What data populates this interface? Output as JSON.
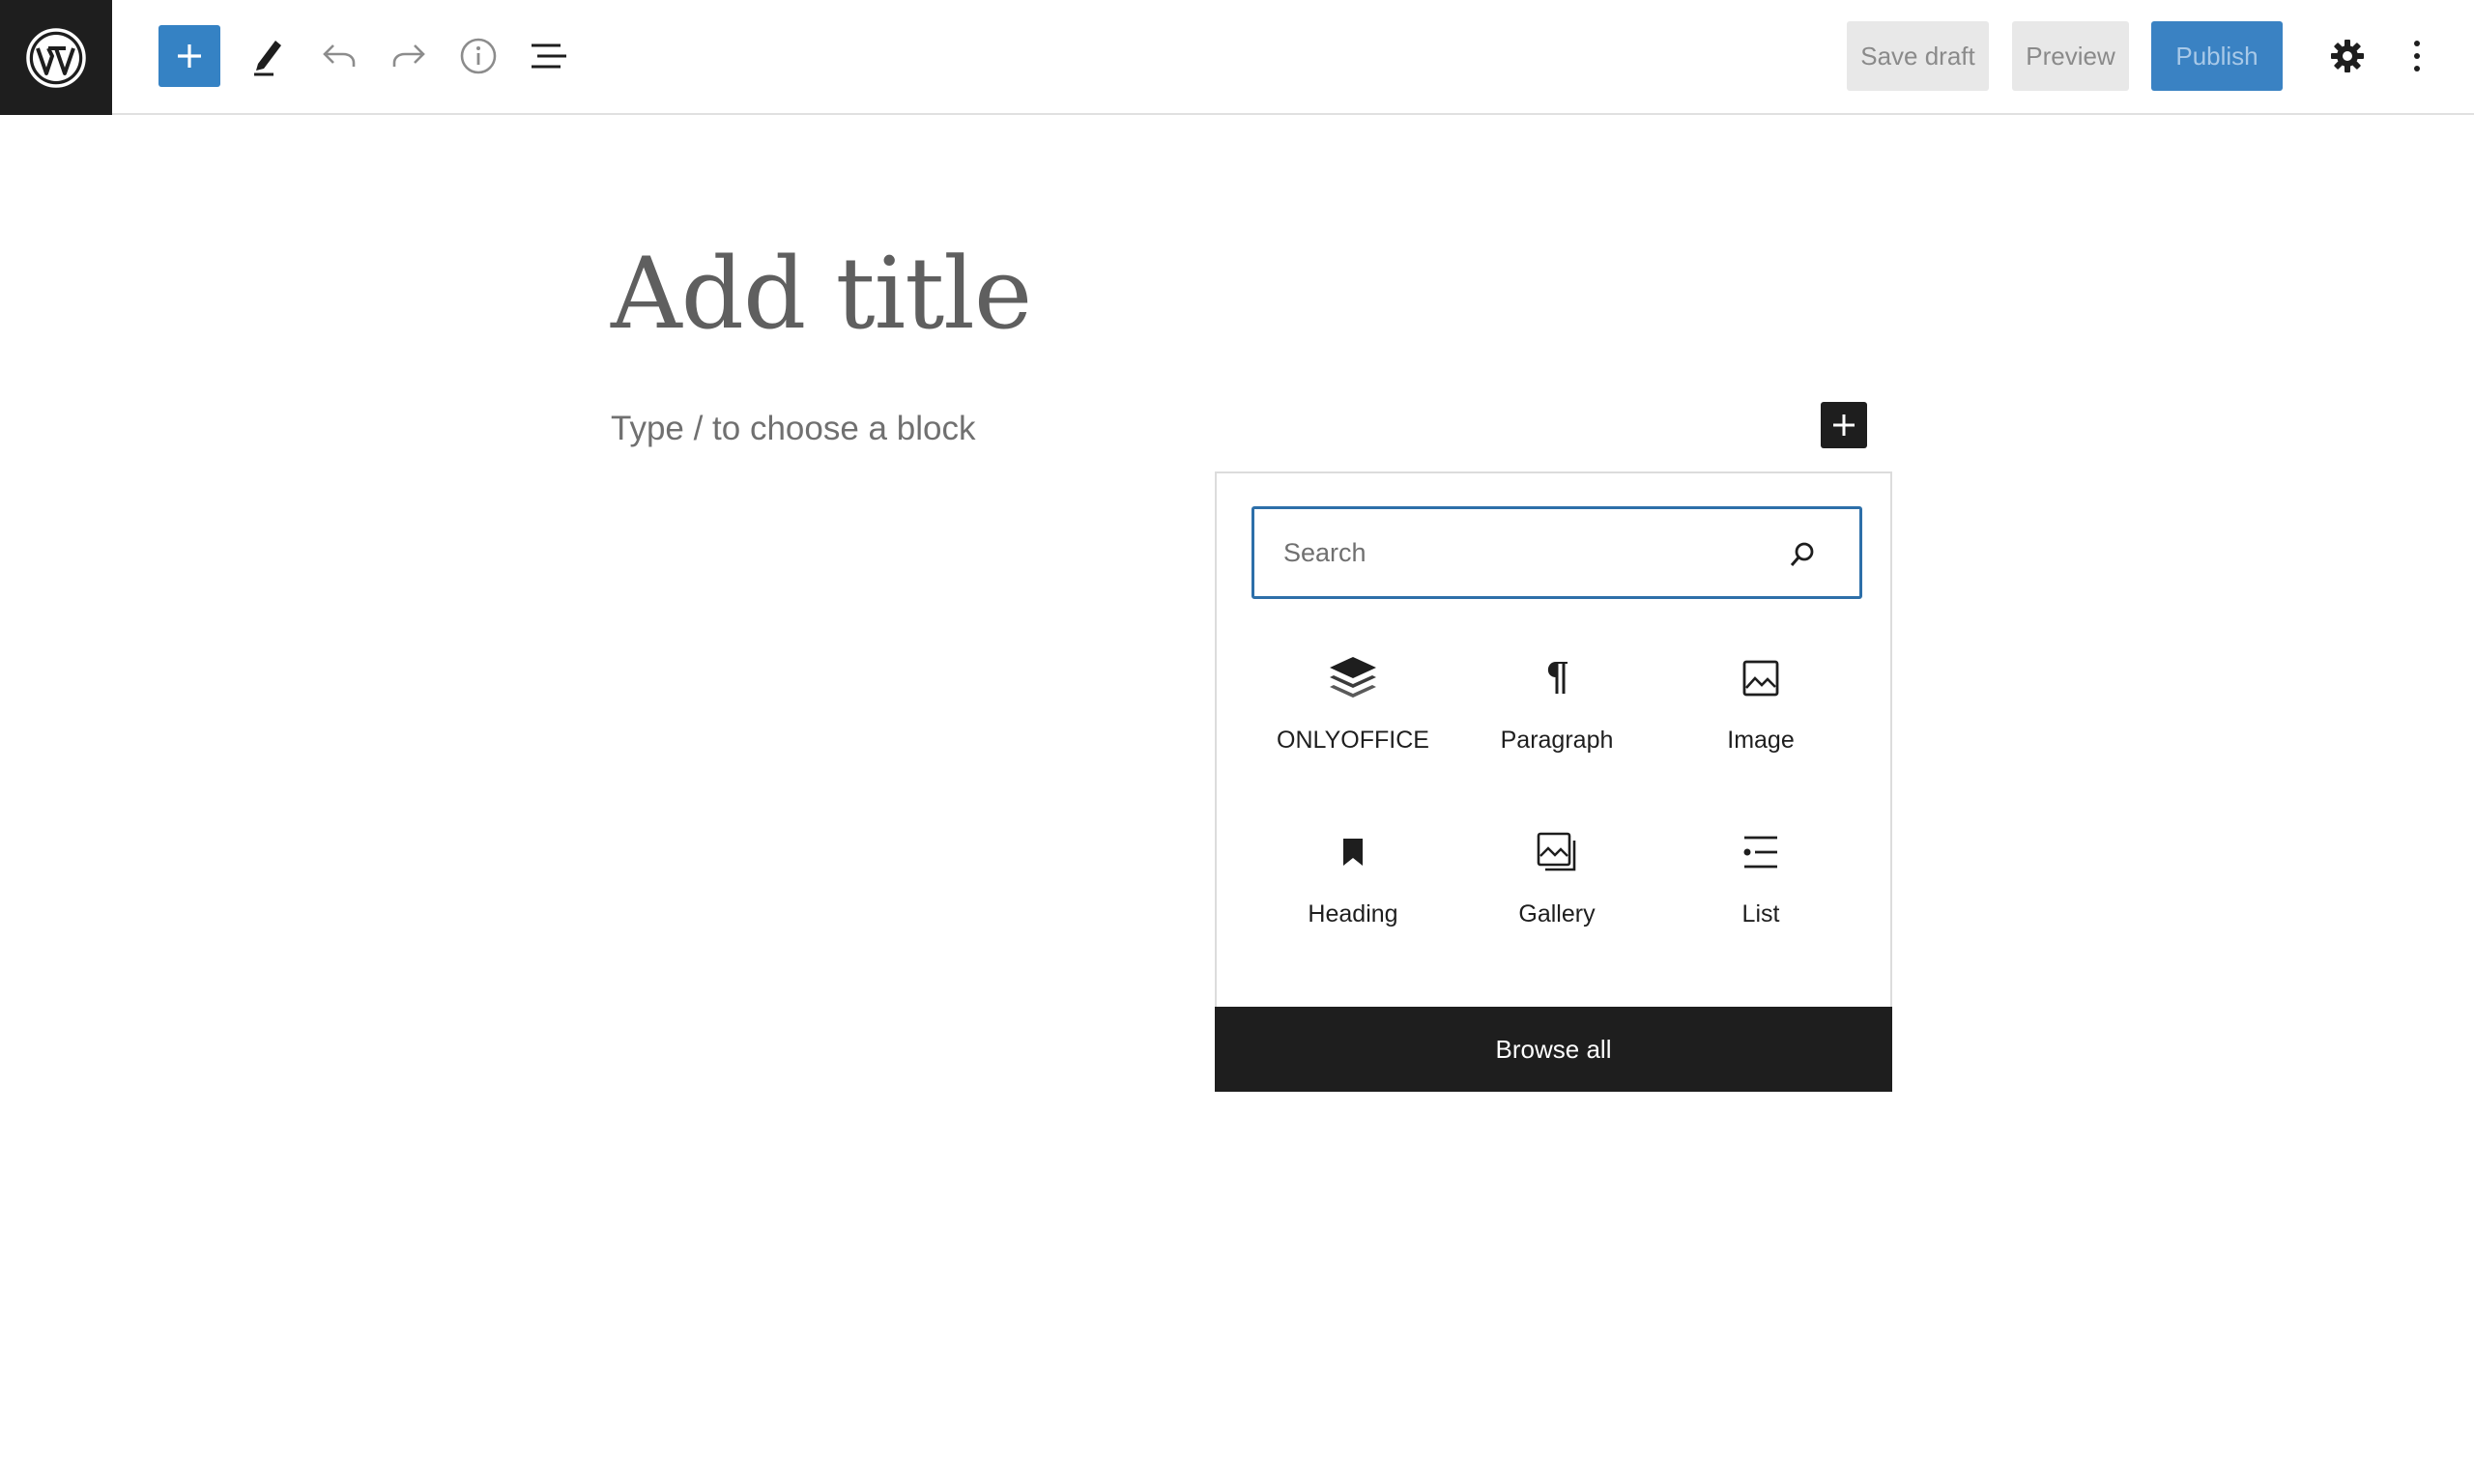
{
  "toolbar": {
    "logo_icon": "wordpress-logo-icon",
    "add_block_icon": "plus-icon",
    "tools_icon": "pencil-icon",
    "undo_icon": "undo-icon",
    "redo_icon": "redo-icon",
    "details_icon": "info-icon",
    "list_view_icon": "list-view-icon",
    "save_draft_label": "Save draft",
    "preview_label": "Preview",
    "publish_label": "Publish",
    "settings_icon": "gear-icon",
    "options_icon": "more-vertical-icon",
    "accent_color": "#3582c4"
  },
  "editor": {
    "title_placeholder": "Add title",
    "block_placeholder": "Type / to choose a block"
  },
  "inserter": {
    "search_placeholder": "Search",
    "blocks": [
      {
        "label": "ONLYOFFICE",
        "icon": "layers-icon"
      },
      {
        "label": "Paragraph",
        "icon": "pilcrow-icon"
      },
      {
        "label": "Image",
        "icon": "image-icon"
      },
      {
        "label": "Heading",
        "icon": "bookmark-icon"
      },
      {
        "label": "Gallery",
        "icon": "gallery-icon"
      },
      {
        "label": "List",
        "icon": "list-icon"
      }
    ],
    "browse_all_label": "Browse all"
  }
}
